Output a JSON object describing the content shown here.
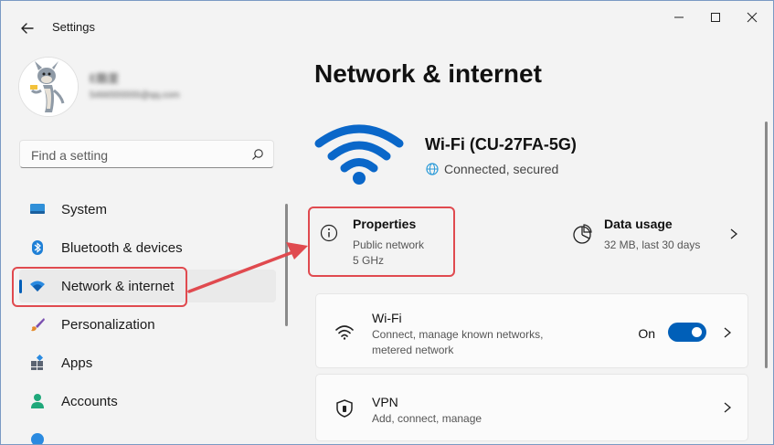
{
  "window": {
    "app_title": "Settings"
  },
  "user": {
    "name": "E酷里",
    "email": "5466555555@qq.com"
  },
  "search": {
    "placeholder": "Find a setting"
  },
  "sidebar": {
    "items": [
      {
        "label": "System",
        "icon": "monitor-icon"
      },
      {
        "label": "Bluetooth & devices",
        "icon": "bluetooth-icon"
      },
      {
        "label": "Network & internet",
        "icon": "wifi-icon",
        "active": true
      },
      {
        "label": "Personalization",
        "icon": "brush-icon"
      },
      {
        "label": "Apps",
        "icon": "apps-icon"
      },
      {
        "label": "Accounts",
        "icon": "person-icon"
      }
    ]
  },
  "main": {
    "page_title": "Network & internet",
    "network": {
      "name": "Wi-Fi (CU-27FA-5G)",
      "status": "Connected, secured"
    },
    "properties": {
      "title": "Properties",
      "line1": "Public network",
      "line2": "5 GHz"
    },
    "data_usage": {
      "title": "Data usage",
      "subtitle": "32 MB, last 30 days"
    },
    "cards": [
      {
        "title": "Wi-Fi",
        "subtitle": "Connect, manage known networks, metered network",
        "toggle_label": "On",
        "toggle_on": true
      },
      {
        "title": "VPN",
        "subtitle": "Add, connect, manage"
      }
    ]
  },
  "colors": {
    "accent": "#005fb8",
    "annotation": "#e04a4f",
    "wifi_icon": "#0a67c9"
  }
}
